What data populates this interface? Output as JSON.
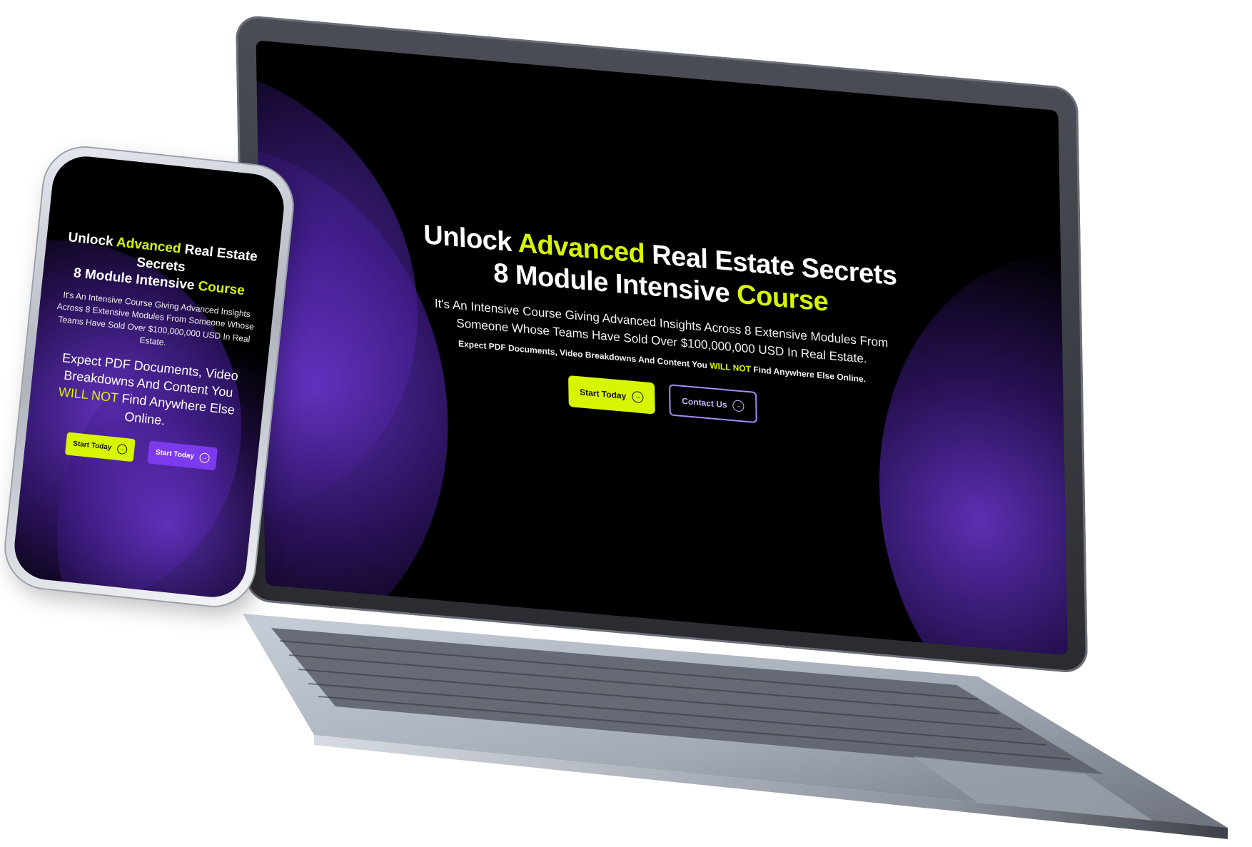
{
  "laptop": {
    "title_part1": "Unlock ",
    "title_accent1": "Advanced",
    "title_part2": " Real Estate Secrets",
    "title_line2_part1": "8 Module Intensive ",
    "title_accent2": "Course",
    "subtitle": "It's An Intensive Course Giving Advanced Insights Across 8 Extensive Modules From Someone Whose Teams Have Sold Over $100,000,000 USD In Real Estate.",
    "expect_part1": "Expect PDF Documents, Video Breakdowns And Content You ",
    "expect_accent": "WILL NOT",
    "expect_part2": " Find Anywhere Else Online.",
    "primary_button_label": "Start Today",
    "secondary_button_label": "Contact Us"
  },
  "phone": {
    "title_part1": "Unlock ",
    "title_accent1": "Advanced",
    "title_part2": " Real Estate Secrets",
    "title_line2_part1": "8 Module Intensive ",
    "title_accent2": "Course",
    "subtitle": "It's An Intensive Course Giving Advanced Insights Across 8 Extensive Modules From Someone Whose Teams Have Sold Over $100,000,000 USD In Real Estate.",
    "expect_part1": "Expect PDF Documents, Video Breakdowns And Content You ",
    "expect_accent": "WILL NOT",
    "expect_part2": " Find Anywhere Else Online.",
    "primary_button_label": "Start Today",
    "secondary_button_label": "Start Today"
  },
  "colors": {
    "accent_lime": "#d8f500",
    "accent_purple": "#7c3aed",
    "outline_purple": "#a78bfa",
    "background": "#000000"
  },
  "icons": {
    "button_arrow": "arrow-right-circle-icon"
  }
}
